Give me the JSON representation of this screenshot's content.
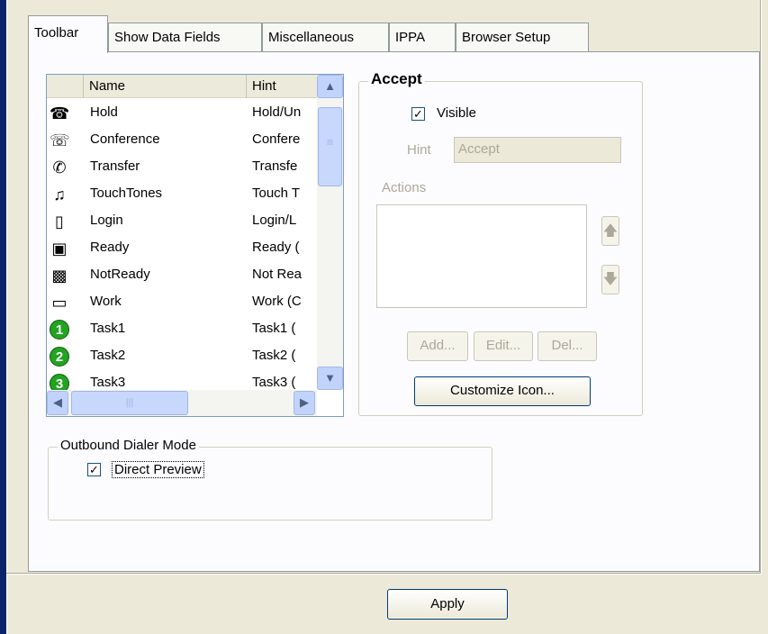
{
  "tabs": [
    {
      "label": "Toolbar",
      "active": true
    },
    {
      "label": "Show Data Fields",
      "active": false
    },
    {
      "label": "Miscellaneous",
      "active": false
    },
    {
      "label": "IPPA",
      "active": false
    },
    {
      "label": "Browser Setup",
      "active": false
    }
  ],
  "list": {
    "columns": [
      "Name",
      "Hint"
    ],
    "rows": [
      {
        "icon": "hold-icon",
        "glyph": "☎",
        "name": "Hold",
        "hint": "Hold/Un"
      },
      {
        "icon": "conference-icon",
        "glyph": "☏",
        "name": "Conference",
        "hint": "Confere"
      },
      {
        "icon": "transfer-icon",
        "glyph": "✆",
        "name": "Transfer",
        "hint": "Transfe"
      },
      {
        "icon": "touchtones-icon",
        "glyph": "♫",
        "name": "TouchTones",
        "hint": "Touch T"
      },
      {
        "icon": "login-icon",
        "glyph": "▯",
        "name": "Login",
        "hint": "Login/L"
      },
      {
        "icon": "ready-icon",
        "glyph": "▣",
        "name": "Ready",
        "hint": "Ready ("
      },
      {
        "icon": "notready-icon",
        "glyph": "▩",
        "name": "NotReady",
        "hint": "Not Rea"
      },
      {
        "icon": "work-icon",
        "glyph": "▭",
        "name": "Work",
        "hint": "Work (C"
      },
      {
        "icon": "task1-icon",
        "glyph": "1",
        "name": "Task1",
        "hint": "Task1 ("
      },
      {
        "icon": "task2-icon",
        "glyph": "2",
        "name": "Task2",
        "hint": "Task2 ("
      },
      {
        "icon": "task3-icon",
        "glyph": "3",
        "name": "Task3",
        "hint": "Task3 ("
      }
    ]
  },
  "accept": {
    "title": "Accept",
    "visible_label": "Visible",
    "visible_checked": true,
    "hint_label": "Hint",
    "hint_value": "Accept",
    "actions_label": "Actions",
    "up_arrow": "🡅",
    "down_arrow": "🡇",
    "add_label": "Add...",
    "edit_label": "Edit...",
    "del_label": "Del...",
    "customize_label": "Customize Icon..."
  },
  "outbound": {
    "title": "Outbound Dialer Mode",
    "direct_preview_label": "Direct Preview",
    "direct_preview_checked": true
  },
  "apply_label": "Apply",
  "colors": {
    "accent": "#0a246a",
    "tab_border": "#919b9c",
    "scroll": "#c1d3fb"
  }
}
